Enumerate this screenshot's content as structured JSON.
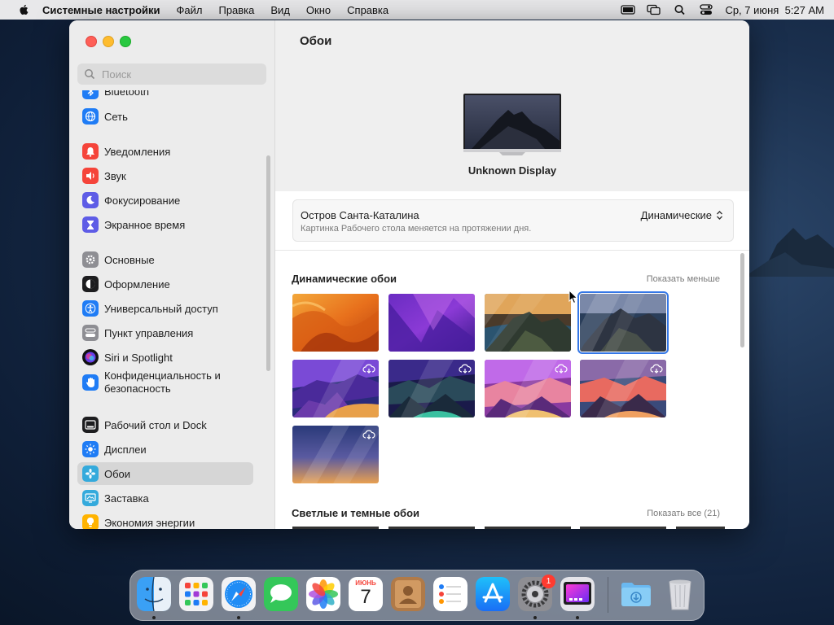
{
  "menubar": {
    "app": "Системные настройки",
    "items": [
      "Файл",
      "Правка",
      "Вид",
      "Окно",
      "Справка"
    ],
    "datetime": "Ср, 7 июня  5:27 AM"
  },
  "sidebar": {
    "search_placeholder": "Поиск",
    "items": [
      {
        "label": "Bluetooth",
        "icon": "bluetooth-icon",
        "color": "#1f7cf5"
      },
      {
        "label": "Сеть",
        "icon": "globe-icon",
        "color": "#1f7cf5"
      },
      {
        "label": "Уведомления",
        "icon": "bell-icon",
        "color": "#f5443a"
      },
      {
        "label": "Звук",
        "icon": "speaker-icon",
        "color": "#f5443a"
      },
      {
        "label": "Фокусирование",
        "icon": "moon-icon",
        "color": "#5e5ce6"
      },
      {
        "label": "Экранное время",
        "icon": "hourglass-icon",
        "color": "#5e5ce6"
      },
      {
        "label": "Основные",
        "icon": "gear-icon",
        "color": "#8e8e93"
      },
      {
        "label": "Оформление",
        "icon": "appearance-icon",
        "color": "#1d1d1f"
      },
      {
        "label": "Универсальный доступ",
        "icon": "accessibility-icon",
        "color": "#1f7cf5"
      },
      {
        "label": "Пункт управления",
        "icon": "control-center-icon",
        "color": "#8e8e93"
      },
      {
        "label": "Siri и Spotlight",
        "icon": "siri-icon",
        "color": "#a23ad6"
      },
      {
        "label": "Конфиденциальность и безопасность",
        "icon": "hand-icon",
        "color": "#1f7cf5"
      },
      {
        "label": "Рабочий стол и Dock",
        "icon": "dock-icon",
        "color": "#1d1d1f"
      },
      {
        "label": "Дисплеи",
        "icon": "sun-icon",
        "color": "#1f7cf5"
      },
      {
        "label": "Обои",
        "icon": "wallpaper-icon",
        "color": "#34aadc"
      },
      {
        "label": "Заставка",
        "icon": "screensaver-icon",
        "color": "#34aadc"
      },
      {
        "label": "Экономия энергии",
        "icon": "bulb-icon",
        "color": "#ffb300"
      }
    ]
  },
  "main": {
    "title": "Обои",
    "display_name": "Unknown Display",
    "wallpaper_name": "Остров Санта-Каталина",
    "wallpaper_desc": "Картинка Рабочего стола меняется на протяжении дня.",
    "mode": "Динамические",
    "section1_title": "Динамические обои",
    "section1_link": "Показать меньше",
    "section2_title": "Светлые и темные обои",
    "section2_link": "Показать все (21)"
  },
  "dock": {
    "calendar_month": "ИЮНЬ",
    "calendar_day": "7",
    "settings_badge": "1"
  }
}
